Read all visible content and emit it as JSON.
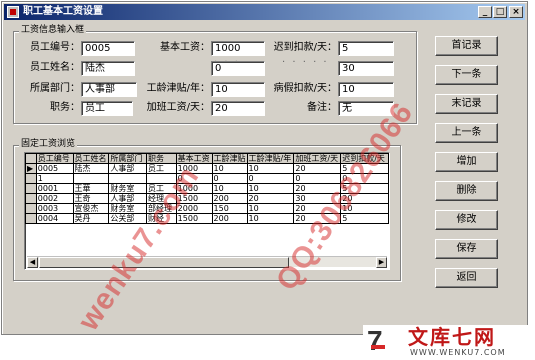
{
  "window": {
    "title": "职工基本工资设置",
    "min_btn": "_",
    "max_btn": "□",
    "close_btn": "×"
  },
  "input_group": {
    "legend": "工资信息输入框",
    "emp_no": {
      "label": "员工编号：",
      "value": "0005"
    },
    "emp_name": {
      "label": "员工姓名：",
      "value": "陆杰"
    },
    "dept": {
      "label": "所属部门：",
      "value": "人事部"
    },
    "position": {
      "label": "职务：",
      "value": "员工"
    },
    "base_salary": {
      "label": "基本工资：",
      "value": "1000"
    },
    "seniority": {
      "label": "工龄津贴/年：",
      "value": "10"
    },
    "overtime": {
      "label": "加班工资/天：",
      "value": "20"
    },
    "late_deduct": {
      "label": "迟到扣款/天：",
      "value": "5"
    },
    "sick_leave": {
      "label": "病假扣款/天：",
      "value": "10"
    },
    "remark": {
      "label": "备注：",
      "value": "无"
    },
    "dotted_value_a": "0",
    "dotted_value_b": "30"
  },
  "grid_group": {
    "legend": "固定工资浏览",
    "columns": [
      "员工编号",
      "员工姓名",
      "所属部门",
      "职务",
      "基本工资",
      "工龄津贴",
      "工龄津贴/年",
      "加班工资/天",
      "迟到扣款/天"
    ],
    "rows": [
      [
        "▶",
        "0005",
        "陆杰",
        "人事部",
        "员工",
        "1000",
        "10",
        "10",
        "20",
        "5"
      ],
      [
        "",
        "1",
        "",
        "",
        "",
        "0",
        "0",
        "0",
        "0",
        "0"
      ],
      [
        "",
        "0001",
        "王華",
        "财务室",
        "员工",
        "1000",
        "10",
        "10",
        "20",
        "5"
      ],
      [
        "",
        "0002",
        "王奇",
        "人事部",
        "经理",
        "1500",
        "200",
        "20",
        "30",
        "20"
      ],
      [
        "",
        "0003",
        "宣俊杰",
        "财务室",
        "部经理",
        "2000",
        "150",
        "10",
        "20",
        "10"
      ],
      [
        "",
        "0004",
        "吴丹",
        "公关部",
        "财经",
        "1500",
        "200",
        "10",
        "20",
        "5"
      ]
    ]
  },
  "buttons": {
    "first": "首记录",
    "next": "下一条",
    "last": "末记录",
    "prev": "上一条",
    "add": "增加",
    "delete": "删除",
    "edit": "修改",
    "save": "保存",
    "back": "返回"
  },
  "watermark": {
    "line1": "wenku7.com",
    "line2": "QQ:306826066"
  },
  "logo": {
    "mark": "7",
    "name": "文库七网",
    "url": "WWW.WENKU7.COM"
  },
  "colors": {
    "face": "#d4d0c8",
    "title_start": "#0a246a",
    "title_end": "#a6caf0",
    "watermark": "#d62828"
  }
}
